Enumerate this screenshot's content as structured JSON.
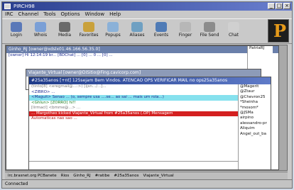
{
  "window": {
    "title": "PIRCH98"
  },
  "menu": [
    "IRC",
    "Channel",
    "Tools",
    "Options",
    "Window",
    "Help"
  ],
  "toolbar": [
    {
      "label": "Login",
      "icon": "login-icon",
      "color": "#5a78b8"
    },
    {
      "label": "Whois",
      "icon": "whois-icon",
      "color": "#7a9fd6"
    },
    {
      "label": "Media",
      "icon": "media-icon",
      "color": "#6a6a6a"
    },
    {
      "label": "Favorites",
      "icon": "favorites-icon",
      "color": "#c9a13b"
    },
    {
      "label": "Popups",
      "icon": "popups-icon",
      "color": "#8bb1d8"
    },
    {
      "label": "Aliases",
      "icon": "aliases-icon",
      "color": "#6fa0c2"
    },
    {
      "label": "Events",
      "icon": "events-icon",
      "color": "#4f7bb6"
    },
    {
      "label": "Finger",
      "icon": "finger-icon",
      "color": "#b7b7b7"
    },
    {
      "label": "File Send",
      "icon": "file-send-icon",
      "color": "#8c8c8c"
    },
    {
      "label": "Chat",
      "icon": "chat-icon",
      "color": "#d0d0d0"
    }
  ],
  "windows": {
    "w1": {
      "title": "Ginho_RJ [owner@xdslx01.46.166.56.35.0]"
    },
    "w2": {
      "title": "Viajante_Virtual [owner@DiSitio@Fing.cavicorp.com]"
    },
    "w3": {
      "title": "#25a35anos [+nt] 125sejam Bem Vindos. ATENCAO OPS VERIFICAR MAIL no ops25a35anos"
    }
  },
  "w1_lines": [
    "[owner] Hi 12:14:19 br... [BDChat] ... [0] ... 0 ... [0] ..."
  ],
  "w1_side": [
    "PatriaRJ"
  ],
  "chat": [
    {
      "text": "(tinto[8] <eregmail@...:>) [ijsn.../...]...",
      "cls": "c-gray"
    },
    {
      "text": "<ZIBRO> ...",
      "cls": "c-blue"
    },
    {
      "text": "<Maguit> Senao ... (o, sempre usa ....se... ao sai ... mais um rola...)",
      "cls": "c-blue"
    },
    {
      "text": "<Ghlun> [ZORRO] hi!!",
      "cls": "c-green"
    },
    {
      "text": "[lirmacl] <bmme@...> ...",
      "cls": "c-gray"
    },
    {
      "text": "... Margotheo kicked Viajante_Virtual from #25a35anos (.OP) Mensagem",
      "cls": "c-red"
    },
    {
      "text": "Automaticas nao sao ... ",
      "cls": "c-red"
    }
  ],
  "nicks": [
    "@Magerit",
    "@Ztaur",
    "@Chevron25",
    "*Sheinha",
    "*mosom*",
    "@JSMa",
    "airpino",
    "alessandro-pr",
    "Aliquim",
    "Angel_out_ba"
  ],
  "taskbar": [
    "irc.brasnet.org PCBanete",
    "Rios",
    "Ginho_RJ",
    "#ratibe",
    "#25a35anos",
    "Viajante_Virtual"
  ],
  "status": "Connected"
}
